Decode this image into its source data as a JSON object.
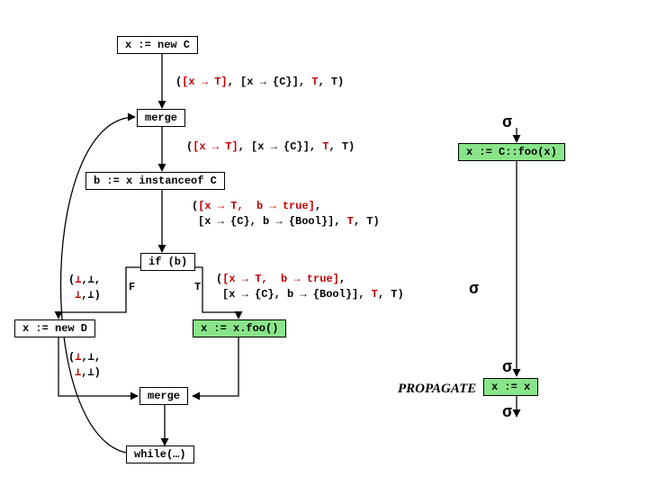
{
  "nodes": {
    "new_c": "x := new C",
    "merge_top": "merge",
    "instanceof": "b := x instanceof C",
    "if_b": "if (b)",
    "new_d": "x := new D",
    "xfoo": "x := x.foo()",
    "merge_bot": "merge",
    "while": "while(…)",
    "cfoo": "x := C::foo(x)",
    "xassign": "x := x"
  },
  "edge": {
    "e1": "([x → T], [x → {C}], T, T)",
    "e2": "([x → T], [x → {C}], T, T)",
    "e3a": "([x → T,   b → true],",
    "e3b": " [x → {C}, b → {Bool}], T, T)",
    "eTa": "([x → T,   b → true],",
    "eTb": " [x → {C}, b → {Bool}], T, T)",
    "eFa": "(⊥,⊥,",
    "eFb": " ⊥,⊥)",
    "eDa": "(⊥,⊥,",
    "eDb": " ⊥,⊥)"
  },
  "branch": {
    "t": "T",
    "f": "F"
  },
  "sigma": "σ",
  "propagate": "PROPAGATE"
}
